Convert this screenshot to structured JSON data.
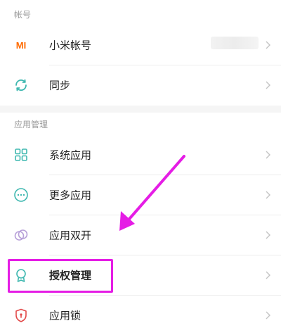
{
  "sections": [
    {
      "header": "帐号"
    },
    {
      "header": "应用管理"
    }
  ],
  "account_rows": [
    {
      "label": "小米帐号",
      "icon": "mi-logo-icon",
      "value_hidden": true
    },
    {
      "label": "同步",
      "icon": "sync-icon"
    }
  ],
  "app_rows": [
    {
      "label": "系统应用",
      "icon": "grid-icon"
    },
    {
      "label": "更多应用",
      "icon": "more-dots-icon"
    },
    {
      "label": "应用双开",
      "icon": "dual-apps-icon"
    },
    {
      "label": "授权管理",
      "icon": "permission-badge-icon"
    },
    {
      "label": "应用锁",
      "icon": "app-lock-icon"
    }
  ],
  "mi_logo_text": "MI",
  "colors": {
    "mi_orange": "#ff6a00",
    "icon_teal": "#3fb8b0",
    "icon_purple": "#b7a0d8",
    "lock_red": "#e24b4b",
    "annotation_magenta": "#e51de5",
    "chevron": "#c4c4c4"
  }
}
